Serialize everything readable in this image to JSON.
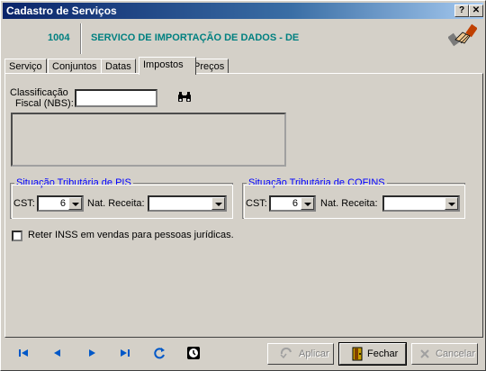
{
  "window": {
    "title": "Cadastro de Serviços",
    "help_label": "?",
    "close_label": "✕"
  },
  "header": {
    "code": "1004",
    "service_name": "SERVICO DE IMPORTAÇÃO DE DADOS - DE"
  },
  "tabs": [
    {
      "label": "Serviço"
    },
    {
      "label": "Conjuntos"
    },
    {
      "label": "Datas"
    },
    {
      "label": "Impostos"
    },
    {
      "label": "Preços"
    }
  ],
  "impostos": {
    "classificacao_label_1": "Classificação",
    "classificacao_label_2": "Fiscal (NBS):",
    "classificacao_value": "",
    "pis": {
      "legend": "Situação Tributária de PIS",
      "cst_label": "CST:",
      "cst_value": "6",
      "nat_label": "Nat. Receita:",
      "nat_value": ""
    },
    "cofins": {
      "legend": "Situação Tributária de COFINS",
      "cst_label": "CST:",
      "cst_value": "6",
      "nat_label": "Nat. Receita:",
      "nat_value": ""
    },
    "reter_inss_label": "Reter INSS em vendas para pessoas jurídicas.",
    "reter_inss_checked": false
  },
  "footer": {
    "aplicar_label": "Aplicar",
    "fechar_label": "Fechar",
    "cancelar_label": "Cancelar"
  },
  "colors": {
    "accent_text": "#008080",
    "legend_text": "#0000ff",
    "nav_icon": "#0058c8"
  }
}
